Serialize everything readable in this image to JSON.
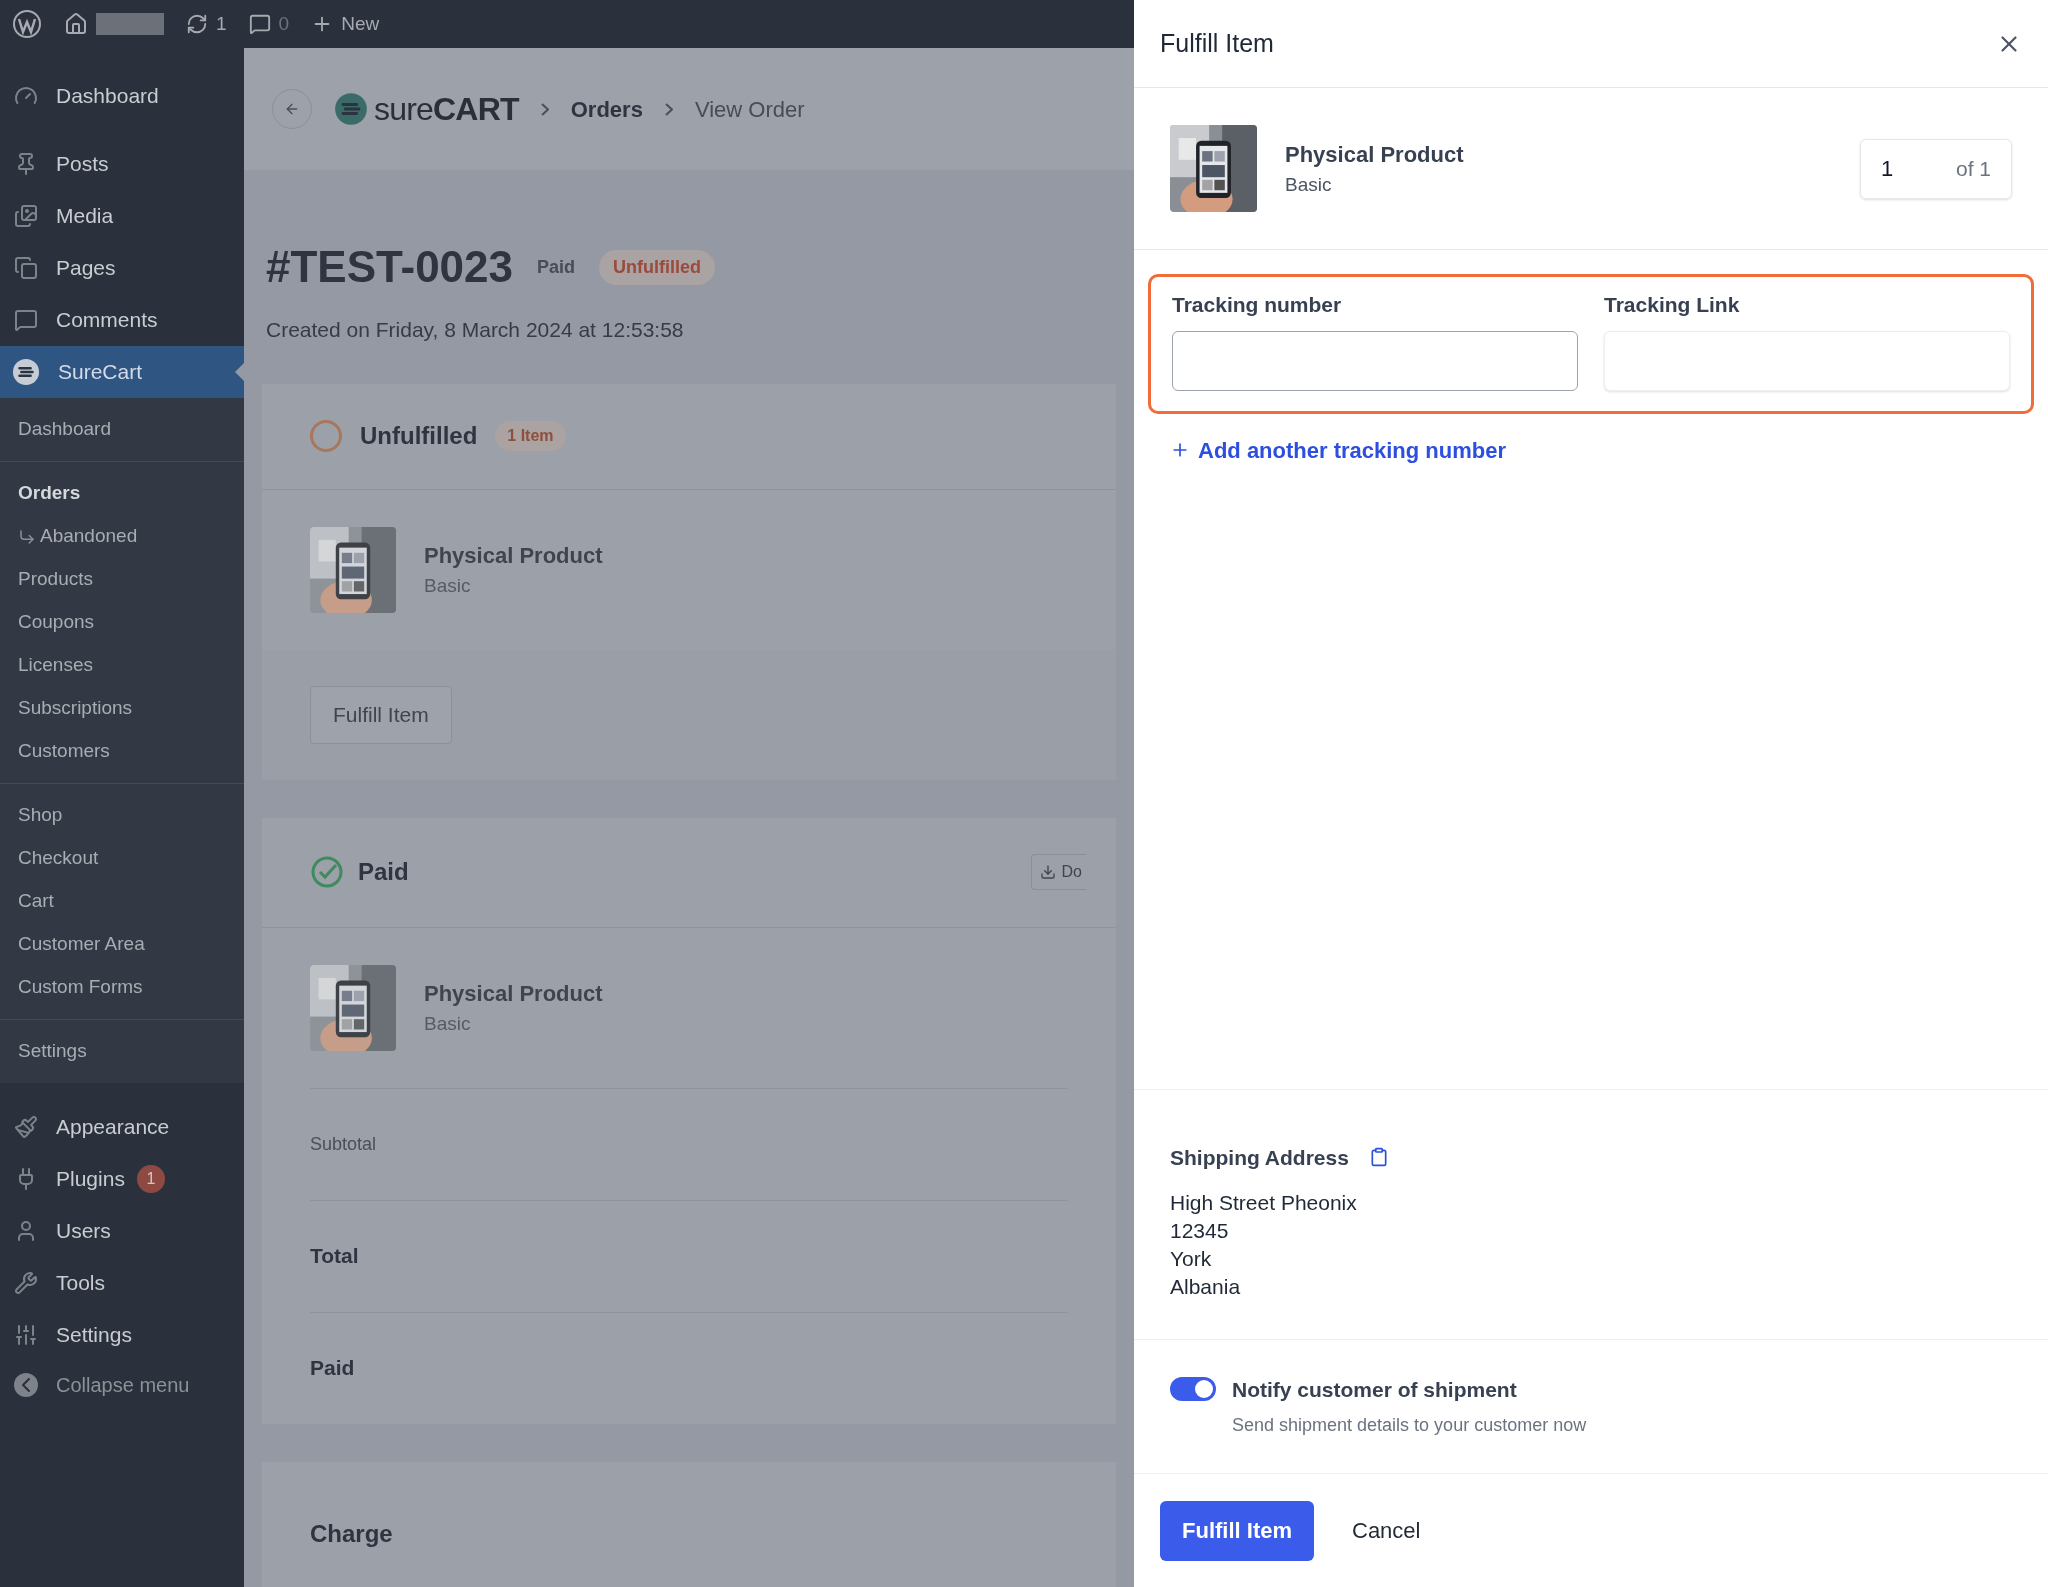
{
  "admin_bar": {
    "updates": "1",
    "comments": "0",
    "new": "New"
  },
  "sidebar": {
    "top": [
      {
        "label": "Dashboard"
      },
      {
        "label": "Posts"
      },
      {
        "label": "Media"
      },
      {
        "label": "Pages"
      },
      {
        "label": "Comments"
      }
    ],
    "active": {
      "label": "SureCart",
      "selected": true
    },
    "submenu": [
      [
        {
          "label": "Dashboard",
          "bold": false,
          "kind": "item"
        }
      ],
      [
        {
          "label": "Orders",
          "bold": true,
          "kind": "item"
        },
        {
          "label": "Abandoned",
          "bold": false,
          "kind": "child"
        },
        {
          "label": "Products",
          "bold": false,
          "kind": "item"
        },
        {
          "label": "Coupons",
          "bold": false,
          "kind": "item"
        },
        {
          "label": "Licenses",
          "bold": false,
          "kind": "item"
        },
        {
          "label": "Subscriptions",
          "bold": false,
          "kind": "item"
        },
        {
          "label": "Customers",
          "bold": false,
          "kind": "item"
        }
      ],
      [
        {
          "label": "Shop",
          "bold": false,
          "kind": "item"
        },
        {
          "label": "Checkout",
          "bold": false,
          "kind": "item"
        },
        {
          "label": "Cart",
          "bold": false,
          "kind": "item"
        },
        {
          "label": "Customer Area",
          "bold": false,
          "kind": "item"
        },
        {
          "label": "Custom Forms",
          "bold": false,
          "kind": "item"
        }
      ],
      [
        {
          "label": "Settings",
          "bold": false,
          "kind": "item"
        }
      ]
    ],
    "bottom": [
      {
        "label": "Appearance"
      },
      {
        "label": "Plugins",
        "badge": "1"
      },
      {
        "label": "Users"
      },
      {
        "label": "Tools"
      },
      {
        "label": "Settings"
      }
    ],
    "collapse": "Collapse menu"
  },
  "header": {
    "logo_light": "sure",
    "logo_bold": "CART",
    "breadcrumbs": [
      {
        "label": "Orders",
        "current": false
      },
      {
        "label": "View Order",
        "current": true
      }
    ]
  },
  "order": {
    "title": "#TEST-0023",
    "payment_badge": "Paid",
    "fulfillment_badge": "Unfulfilled",
    "created": "Created on Friday, 8 March 2024 at 12:53:58"
  },
  "unfulfilled_card": {
    "title": "Unfulfilled",
    "count": "1 Item",
    "product": {
      "name": "Physical Product",
      "variant": "Basic"
    },
    "button": "Fulfill Item"
  },
  "paid_card": {
    "title": "Paid",
    "download": "Do",
    "product": {
      "name": "Physical Product",
      "variant": "Basic"
    },
    "rows": [
      {
        "label": "Subtotal",
        "bold": false
      },
      {
        "label": "Total",
        "bold": true
      },
      {
        "label": "Paid",
        "bold": true
      }
    ]
  },
  "charge_card": {
    "title": "Charge"
  },
  "drawer": {
    "title": "Fulfill Item",
    "product": {
      "name": "Physical Product",
      "variant": "Basic",
      "quantity": "1",
      "of": "of 1"
    },
    "fields": [
      {
        "label": "Tracking number",
        "focused": true
      },
      {
        "label": "Tracking Link",
        "focused": false
      }
    ],
    "add_link": "Add another tracking number",
    "shipping": {
      "title": "Shipping Address",
      "lines": [
        "High Street Pheonix",
        "12345",
        "York",
        "Albania"
      ]
    },
    "notify": {
      "on": true,
      "label": "Notify customer of shipment",
      "help": "Send shipment details to your customer now"
    },
    "buttons": {
      "primary": "Fulfill Item",
      "secondary": "Cancel"
    }
  }
}
